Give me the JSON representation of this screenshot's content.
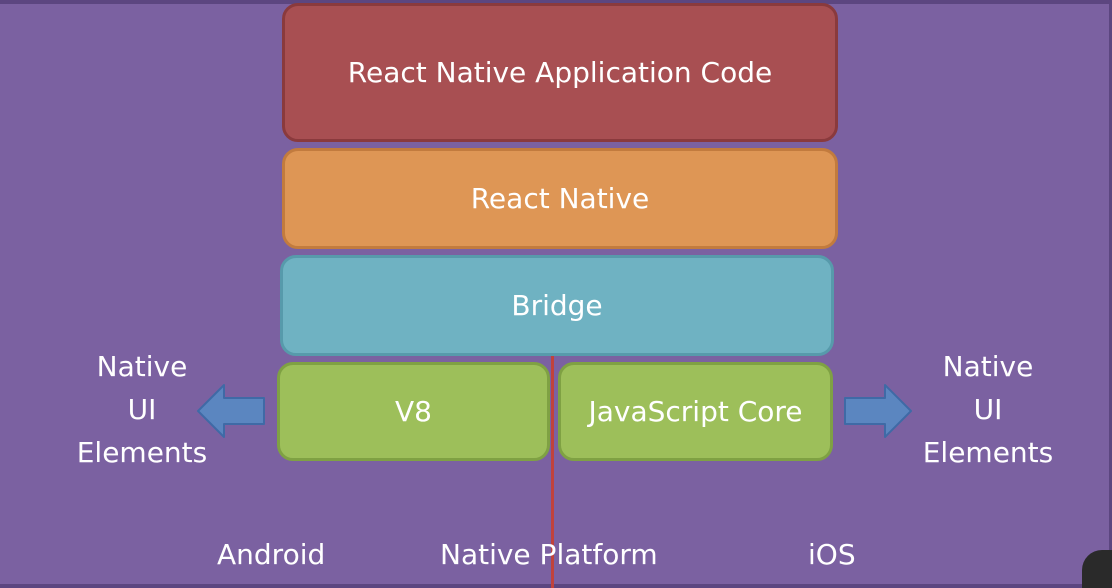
{
  "diagram": {
    "blocks": {
      "app_code": "React Native Application Code",
      "react_native": "React Native",
      "bridge": "Bridge",
      "v8": "V8",
      "javascript_core": "JavaScript Core"
    },
    "left_side": {
      "lines": [
        "Native",
        "UI",
        "Elements"
      ]
    },
    "right_side": {
      "lines": [
        "Native",
        "UI",
        "Elements"
      ]
    },
    "bottom": {
      "android": "Android",
      "native_platform": "Native Platform",
      "ios": "iOS"
    }
  },
  "colors": {
    "background": "#7b61a1",
    "app_code": "#a84f52",
    "react_native": "#de9655",
    "bridge": "#6fb2c2",
    "engine": "#9dbf5a",
    "arrow": "#5b86c0",
    "divider": "#c0423c"
  }
}
